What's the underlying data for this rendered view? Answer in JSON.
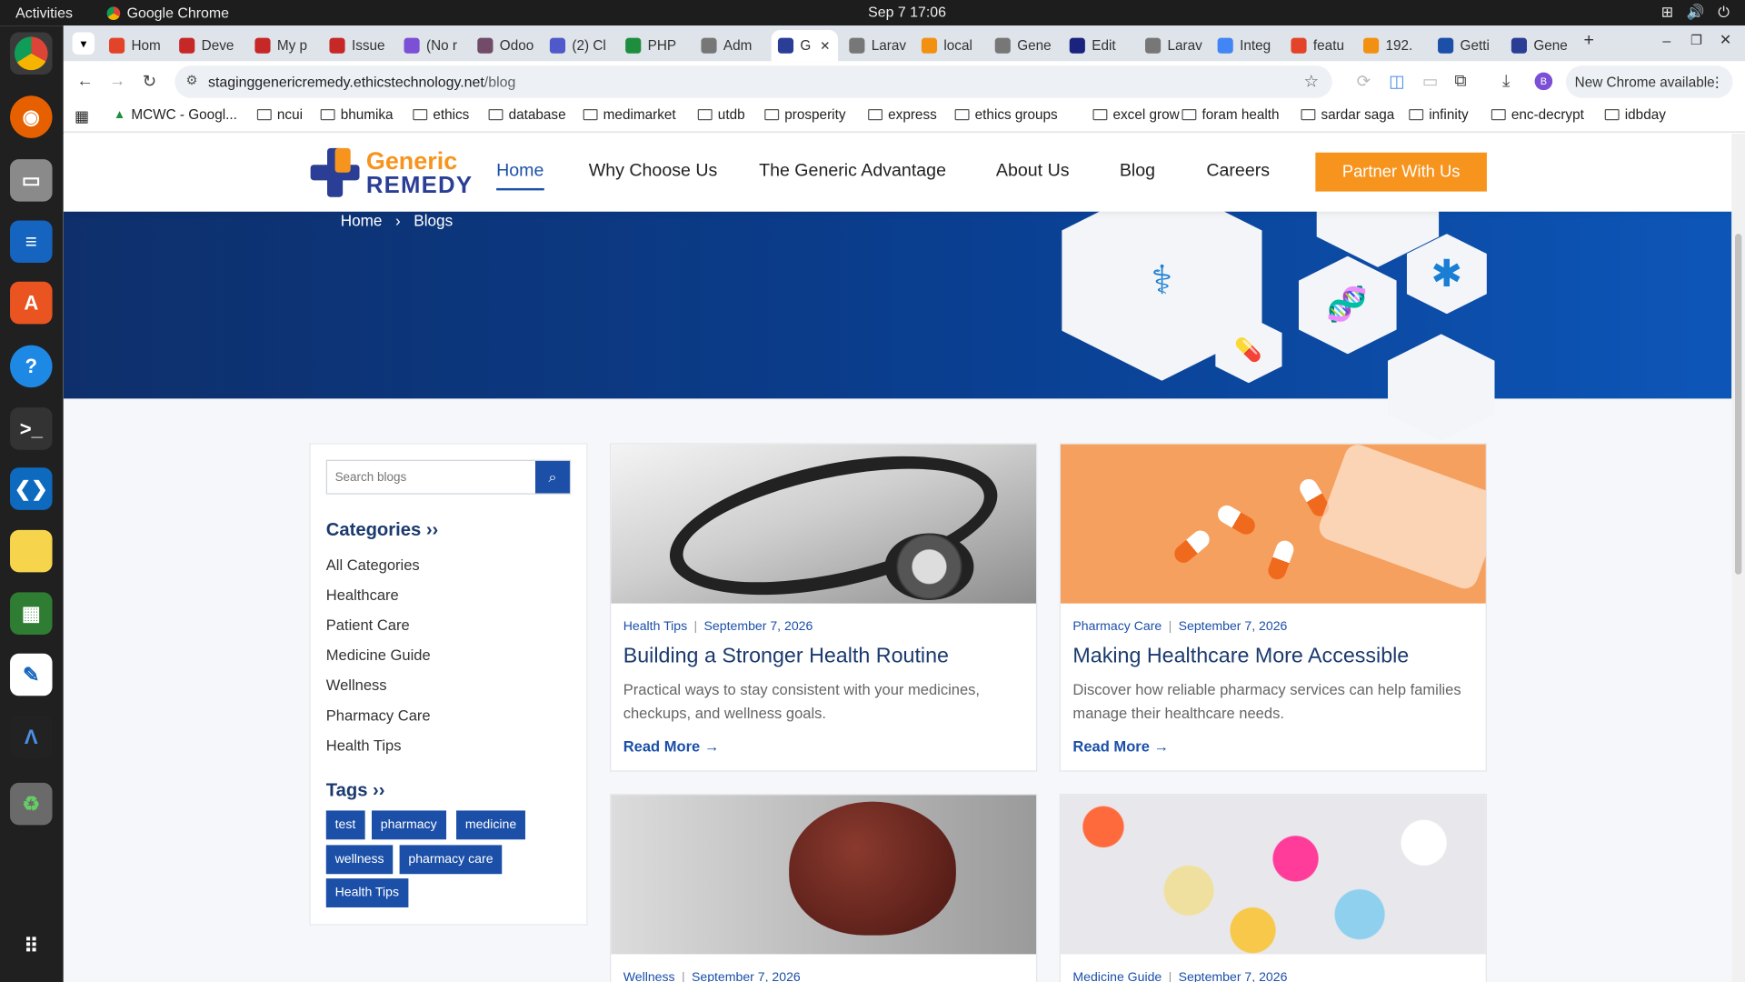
{
  "system": {
    "activities": "Activities",
    "app_name": "Google Chrome",
    "clock": "Sep 7  17:06"
  },
  "tabs": [
    {
      "label": "Hom",
      "color": "#e24329"
    },
    {
      "label": "Deve",
      "color": "#c62828"
    },
    {
      "label": "My p",
      "color": "#c62828"
    },
    {
      "label": "Issue",
      "color": "#c62828"
    },
    {
      "label": "(No r",
      "color": "#7b4fd6"
    },
    {
      "label": "Odoo",
      "color": "#714b67"
    },
    {
      "label": "(2) Cl",
      "color": "#5059c9"
    },
    {
      "label": "PHP",
      "color": "#1e8e3e"
    },
    {
      "label": "Adm",
      "color": "#777777"
    },
    {
      "label": "G",
      "color": "#2a3e95",
      "active": true
    },
    {
      "label": "Larav",
      "color": "#777777"
    },
    {
      "label": "local",
      "color": "#f29111"
    },
    {
      "label": "Gene",
      "color": "#777777"
    },
    {
      "label": "Edit",
      "color": "#1a237e"
    },
    {
      "label": "Larav",
      "color": "#777777"
    },
    {
      "label": "Integ",
      "color": "#4285f4"
    },
    {
      "label": "featu",
      "color": "#e24329"
    },
    {
      "label": "192.",
      "color": "#f29111"
    },
    {
      "label": "Getti",
      "color": "#1b4fa8"
    },
    {
      "label": "Gene",
      "color": "#2a3e95"
    }
  ],
  "address": {
    "host": "staginggenericremedy.ethicstechnology.net",
    "path": "/blog",
    "new_chrome": "New Chrome available"
  },
  "bookmarks": [
    "MCWC - Googl...",
    "ncui",
    "bhumika",
    "ethics",
    "database",
    "medimarket",
    "utdb",
    "prosperity",
    "express",
    "ethics groups",
    "excel grow",
    "foram health",
    "sardar saga",
    "infinity",
    "enc-decrypt",
    "idbday"
  ],
  "site": {
    "logo_top": "Generic",
    "logo_bottom": "REMEDY",
    "menu": [
      "Home",
      "Why Choose Us",
      "The Generic Advantage",
      "About Us",
      "Blog",
      "Careers"
    ],
    "cta": "Partner With Us"
  },
  "hero": {
    "crumb_home": "Home",
    "crumb_sep": "›",
    "crumb_current": "Blogs"
  },
  "sidebar": {
    "search_placeholder": "Search blogs",
    "search_icon": "⌕",
    "categories_title": "Categories ››",
    "categories": [
      "All Categories",
      "Healthcare",
      "Patient Care",
      "Medicine Guide",
      "Wellness",
      "Pharmacy Care",
      "Health Tips"
    ],
    "tags_title": "Tags ››",
    "tags": [
      "test",
      "pharmacy",
      "medicine",
      "wellness",
      "pharmacy care",
      "Health Tips"
    ]
  },
  "posts": [
    {
      "category": "Health Tips",
      "date": "September 7, 2026",
      "title": "Building a Stronger Health Routine",
      "desc": "Practical ways to stay consistent with your medicines, checkups, and wellness goals.",
      "more": "Read More →"
    },
    {
      "category": "Pharmacy Care",
      "date": "September 7, 2026",
      "title": "Making Healthcare More Accessible",
      "desc": "Discover how reliable pharmacy services can help families manage their healthcare needs.",
      "more": "Read More →"
    },
    {
      "category": "Wellness",
      "date": "September 7, 2026"
    },
    {
      "category": "Medicine Guide",
      "date": "September 7, 2026"
    }
  ]
}
